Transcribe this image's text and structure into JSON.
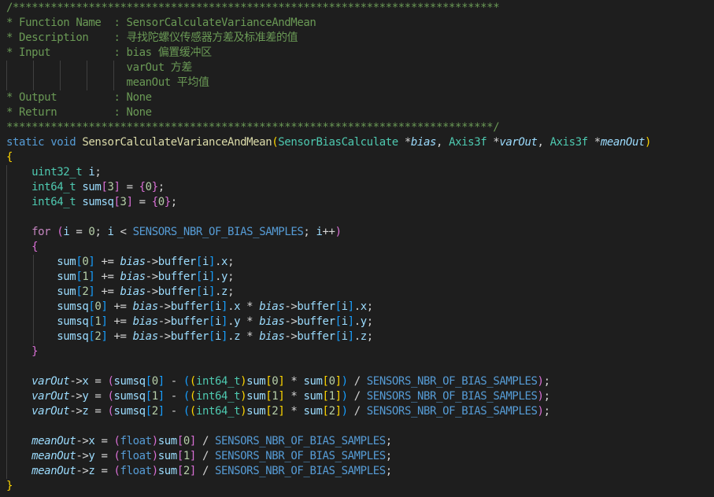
{
  "editor": {
    "theme_colors": {
      "background": "#1e1e1e",
      "comment": "#6a9955",
      "keyword": "#569cd6",
      "control": "#c586c0",
      "function": "#dcdcaa",
      "type": "#4ec9b0",
      "variable": "#9cdcfe",
      "number": "#b5cea8",
      "bracket_level1": "#ffd700",
      "bracket_level2": "#da70d6",
      "bracket_level3": "#179fff"
    },
    "lines": [
      [
        [
          "com",
          "/*****************************************************************************"
        ]
      ],
      [
        [
          "com",
          "* Function Name  : SensorCalculateVarianceAndMean"
        ]
      ],
      [
        [
          "com",
          "* Description    : 寻找陀螺仪传感器方差及标准差的值"
        ]
      ],
      [
        [
          "com",
          "* Input          : bias 偏置缓冲区"
        ]
      ],
      [
        [
          "com",
          "                   varOut 方差"
        ]
      ],
      [
        [
          "com",
          "                   meanOut 平均值"
        ]
      ],
      [
        [
          "com",
          "* Output         : None"
        ]
      ],
      [
        [
          "com",
          "* Return         : None"
        ]
      ],
      [
        [
          "com",
          "*****************************************************************************/"
        ]
      ],
      [
        [
          "kw",
          "static"
        ],
        [
          "pun",
          " "
        ],
        [
          "kw",
          "void"
        ],
        [
          "pun",
          " "
        ],
        [
          "fn",
          "SensorCalculateVarianceAndMean"
        ],
        [
          "b1",
          "("
        ],
        [
          "type",
          "SensorBiasCalculate"
        ],
        [
          "pun",
          " *"
        ],
        [
          "par",
          "bias"
        ],
        [
          "pun",
          ", "
        ],
        [
          "type",
          "Axis3f"
        ],
        [
          "pun",
          " *"
        ],
        [
          "par",
          "varOut"
        ],
        [
          "pun",
          ", "
        ],
        [
          "type",
          "Axis3f"
        ],
        [
          "pun",
          " *"
        ],
        [
          "par",
          "meanOut"
        ],
        [
          "b1",
          ")"
        ]
      ],
      [
        [
          "b1",
          "{"
        ]
      ],
      [
        [
          "pun",
          "    "
        ],
        [
          "type",
          "uint32_t"
        ],
        [
          "pun",
          " "
        ],
        [
          "var",
          "i"
        ],
        [
          "pun",
          ";"
        ]
      ],
      [
        [
          "pun",
          "    "
        ],
        [
          "type",
          "int64_t"
        ],
        [
          "pun",
          " "
        ],
        [
          "var",
          "sum"
        ],
        [
          "b2",
          "["
        ],
        [
          "num",
          "3"
        ],
        [
          "b2",
          "]"
        ],
        [
          "pun",
          " = "
        ],
        [
          "b2",
          "{"
        ],
        [
          "num",
          "0"
        ],
        [
          "b2",
          "}"
        ],
        [
          "pun",
          ";"
        ]
      ],
      [
        [
          "pun",
          "    "
        ],
        [
          "type",
          "int64_t"
        ],
        [
          "pun",
          " "
        ],
        [
          "var",
          "sumsq"
        ],
        [
          "b2",
          "["
        ],
        [
          "num",
          "3"
        ],
        [
          "b2",
          "]"
        ],
        [
          "pun",
          " = "
        ],
        [
          "b2",
          "{"
        ],
        [
          "num",
          "0"
        ],
        [
          "b2",
          "}"
        ],
        [
          "pun",
          ";"
        ]
      ],
      [
        [
          "pun",
          ""
        ]
      ],
      [
        [
          "pun",
          "    "
        ],
        [
          "ctl",
          "for"
        ],
        [
          "pun",
          " "
        ],
        [
          "b2",
          "("
        ],
        [
          "var",
          "i"
        ],
        [
          "pun",
          " = "
        ],
        [
          "num",
          "0"
        ],
        [
          "pun",
          "; "
        ],
        [
          "var",
          "i"
        ],
        [
          "pun",
          " < "
        ],
        [
          "mac",
          "SENSORS_NBR_OF_BIAS_SAMPLES"
        ],
        [
          "pun",
          "; "
        ],
        [
          "var",
          "i"
        ],
        [
          "pun",
          "++"
        ],
        [
          "b2",
          ")"
        ]
      ],
      [
        [
          "pun",
          "    "
        ],
        [
          "b2",
          "{"
        ]
      ],
      [
        [
          "pun",
          "        "
        ],
        [
          "var",
          "sum"
        ],
        [
          "b3",
          "["
        ],
        [
          "num",
          "0"
        ],
        [
          "b3",
          "]"
        ],
        [
          "pun",
          " += "
        ],
        [
          "par",
          "bias"
        ],
        [
          "pun",
          "->"
        ],
        [
          "var",
          "buffer"
        ],
        [
          "b3",
          "["
        ],
        [
          "var",
          "i"
        ],
        [
          "b3",
          "]"
        ],
        [
          "pun",
          "."
        ],
        [
          "var",
          "x"
        ],
        [
          "pun",
          ";"
        ]
      ],
      [
        [
          "pun",
          "        "
        ],
        [
          "var",
          "sum"
        ],
        [
          "b3",
          "["
        ],
        [
          "num",
          "1"
        ],
        [
          "b3",
          "]"
        ],
        [
          "pun",
          " += "
        ],
        [
          "par",
          "bias"
        ],
        [
          "pun",
          "->"
        ],
        [
          "var",
          "buffer"
        ],
        [
          "b3",
          "["
        ],
        [
          "var",
          "i"
        ],
        [
          "b3",
          "]"
        ],
        [
          "pun",
          "."
        ],
        [
          "var",
          "y"
        ],
        [
          "pun",
          ";"
        ]
      ],
      [
        [
          "pun",
          "        "
        ],
        [
          "var",
          "sum"
        ],
        [
          "b3",
          "["
        ],
        [
          "num",
          "2"
        ],
        [
          "b3",
          "]"
        ],
        [
          "pun",
          " += "
        ],
        [
          "par",
          "bias"
        ],
        [
          "pun",
          "->"
        ],
        [
          "var",
          "buffer"
        ],
        [
          "b3",
          "["
        ],
        [
          "var",
          "i"
        ],
        [
          "b3",
          "]"
        ],
        [
          "pun",
          "."
        ],
        [
          "var",
          "z"
        ],
        [
          "pun",
          ";"
        ]
      ],
      [
        [
          "pun",
          "        "
        ],
        [
          "var",
          "sumsq"
        ],
        [
          "b3",
          "["
        ],
        [
          "num",
          "0"
        ],
        [
          "b3",
          "]"
        ],
        [
          "pun",
          " += "
        ],
        [
          "par",
          "bias"
        ],
        [
          "pun",
          "->"
        ],
        [
          "var",
          "buffer"
        ],
        [
          "b3",
          "["
        ],
        [
          "var",
          "i"
        ],
        [
          "b3",
          "]"
        ],
        [
          "pun",
          "."
        ],
        [
          "var",
          "x"
        ],
        [
          "pun",
          " * "
        ],
        [
          "par",
          "bias"
        ],
        [
          "pun",
          "->"
        ],
        [
          "var",
          "buffer"
        ],
        [
          "b3",
          "["
        ],
        [
          "var",
          "i"
        ],
        [
          "b3",
          "]"
        ],
        [
          "pun",
          "."
        ],
        [
          "var",
          "x"
        ],
        [
          "pun",
          ";"
        ]
      ],
      [
        [
          "pun",
          "        "
        ],
        [
          "var",
          "sumsq"
        ],
        [
          "b3",
          "["
        ],
        [
          "num",
          "1"
        ],
        [
          "b3",
          "]"
        ],
        [
          "pun",
          " += "
        ],
        [
          "par",
          "bias"
        ],
        [
          "pun",
          "->"
        ],
        [
          "var",
          "buffer"
        ],
        [
          "b3",
          "["
        ],
        [
          "var",
          "i"
        ],
        [
          "b3",
          "]"
        ],
        [
          "pun",
          "."
        ],
        [
          "var",
          "y"
        ],
        [
          "pun",
          " * "
        ],
        [
          "par",
          "bias"
        ],
        [
          "pun",
          "->"
        ],
        [
          "var",
          "buffer"
        ],
        [
          "b3",
          "["
        ],
        [
          "var",
          "i"
        ],
        [
          "b3",
          "]"
        ],
        [
          "pun",
          "."
        ],
        [
          "var",
          "y"
        ],
        [
          "pun",
          ";"
        ]
      ],
      [
        [
          "pun",
          "        "
        ],
        [
          "var",
          "sumsq"
        ],
        [
          "b3",
          "["
        ],
        [
          "num",
          "2"
        ],
        [
          "b3",
          "]"
        ],
        [
          "pun",
          " += "
        ],
        [
          "par",
          "bias"
        ],
        [
          "pun",
          "->"
        ],
        [
          "var",
          "buffer"
        ],
        [
          "b3",
          "["
        ],
        [
          "var",
          "i"
        ],
        [
          "b3",
          "]"
        ],
        [
          "pun",
          "."
        ],
        [
          "var",
          "z"
        ],
        [
          "pun",
          " * "
        ],
        [
          "par",
          "bias"
        ],
        [
          "pun",
          "->"
        ],
        [
          "var",
          "buffer"
        ],
        [
          "b3",
          "["
        ],
        [
          "var",
          "i"
        ],
        [
          "b3",
          "]"
        ],
        [
          "pun",
          "."
        ],
        [
          "var",
          "z"
        ],
        [
          "pun",
          ";"
        ]
      ],
      [
        [
          "pun",
          "    "
        ],
        [
          "b2",
          "}"
        ]
      ],
      [
        [
          "pun",
          ""
        ]
      ],
      [
        [
          "pun",
          "    "
        ],
        [
          "par",
          "varOut"
        ],
        [
          "pun",
          "->"
        ],
        [
          "var",
          "x"
        ],
        [
          "pun",
          " = "
        ],
        [
          "b2",
          "("
        ],
        [
          "var",
          "sumsq"
        ],
        [
          "b3",
          "["
        ],
        [
          "num",
          "0"
        ],
        [
          "b3",
          "]"
        ],
        [
          "pun",
          " - "
        ],
        [
          "b3",
          "("
        ],
        [
          "b1",
          "("
        ],
        [
          "type",
          "int64_t"
        ],
        [
          "b1",
          ")"
        ],
        [
          "var",
          "sum"
        ],
        [
          "b1",
          "["
        ],
        [
          "num",
          "0"
        ],
        [
          "b1",
          "]"
        ],
        [
          "pun",
          " * "
        ],
        [
          "var",
          "sum"
        ],
        [
          "b1",
          "["
        ],
        [
          "num",
          "0"
        ],
        [
          "b1",
          "]"
        ],
        [
          "b3",
          ")"
        ],
        [
          "pun",
          " / "
        ],
        [
          "mac",
          "SENSORS_NBR_OF_BIAS_SAMPLES"
        ],
        [
          "b2",
          ")"
        ],
        [
          "pun",
          ";"
        ]
      ],
      [
        [
          "pun",
          "    "
        ],
        [
          "par",
          "varOut"
        ],
        [
          "pun",
          "->"
        ],
        [
          "var",
          "y"
        ],
        [
          "pun",
          " = "
        ],
        [
          "b2",
          "("
        ],
        [
          "var",
          "sumsq"
        ],
        [
          "b3",
          "["
        ],
        [
          "num",
          "1"
        ],
        [
          "b3",
          "]"
        ],
        [
          "pun",
          " - "
        ],
        [
          "b3",
          "("
        ],
        [
          "b1",
          "("
        ],
        [
          "type",
          "int64_t"
        ],
        [
          "b1",
          ")"
        ],
        [
          "var",
          "sum"
        ],
        [
          "b1",
          "["
        ],
        [
          "num",
          "1"
        ],
        [
          "b1",
          "]"
        ],
        [
          "pun",
          " * "
        ],
        [
          "var",
          "sum"
        ],
        [
          "b1",
          "["
        ],
        [
          "num",
          "1"
        ],
        [
          "b1",
          "]"
        ],
        [
          "b3",
          ")"
        ],
        [
          "pun",
          " / "
        ],
        [
          "mac",
          "SENSORS_NBR_OF_BIAS_SAMPLES"
        ],
        [
          "b2",
          ")"
        ],
        [
          "pun",
          ";"
        ]
      ],
      [
        [
          "pun",
          "    "
        ],
        [
          "par",
          "varOut"
        ],
        [
          "pun",
          "->"
        ],
        [
          "var",
          "z"
        ],
        [
          "pun",
          " = "
        ],
        [
          "b2",
          "("
        ],
        [
          "var",
          "sumsq"
        ],
        [
          "b3",
          "["
        ],
        [
          "num",
          "2"
        ],
        [
          "b3",
          "]"
        ],
        [
          "pun",
          " - "
        ],
        [
          "b3",
          "("
        ],
        [
          "b1",
          "("
        ],
        [
          "type",
          "int64_t"
        ],
        [
          "b1",
          ")"
        ],
        [
          "var",
          "sum"
        ],
        [
          "b1",
          "["
        ],
        [
          "num",
          "2"
        ],
        [
          "b1",
          "]"
        ],
        [
          "pun",
          " * "
        ],
        [
          "var",
          "sum"
        ],
        [
          "b1",
          "["
        ],
        [
          "num",
          "2"
        ],
        [
          "b1",
          "]"
        ],
        [
          "b3",
          ")"
        ],
        [
          "pun",
          " / "
        ],
        [
          "mac",
          "SENSORS_NBR_OF_BIAS_SAMPLES"
        ],
        [
          "b2",
          ")"
        ],
        [
          "pun",
          ";"
        ]
      ],
      [
        [
          "pun",
          ""
        ]
      ],
      [
        [
          "pun",
          "    "
        ],
        [
          "par",
          "meanOut"
        ],
        [
          "pun",
          "->"
        ],
        [
          "var",
          "x"
        ],
        [
          "pun",
          " = "
        ],
        [
          "b2",
          "("
        ],
        [
          "kw",
          "float"
        ],
        [
          "b2",
          ")"
        ],
        [
          "var",
          "sum"
        ],
        [
          "b2",
          "["
        ],
        [
          "num",
          "0"
        ],
        [
          "b2",
          "]"
        ],
        [
          "pun",
          " / "
        ],
        [
          "mac",
          "SENSORS_NBR_OF_BIAS_SAMPLES"
        ],
        [
          "pun",
          ";"
        ]
      ],
      [
        [
          "pun",
          "    "
        ],
        [
          "par",
          "meanOut"
        ],
        [
          "pun",
          "->"
        ],
        [
          "var",
          "y"
        ],
        [
          "pun",
          " = "
        ],
        [
          "b2",
          "("
        ],
        [
          "kw",
          "float"
        ],
        [
          "b2",
          ")"
        ],
        [
          "var",
          "sum"
        ],
        [
          "b2",
          "["
        ],
        [
          "num",
          "1"
        ],
        [
          "b2",
          "]"
        ],
        [
          "pun",
          " / "
        ],
        [
          "mac",
          "SENSORS_NBR_OF_BIAS_SAMPLES"
        ],
        [
          "pun",
          ";"
        ]
      ],
      [
        [
          "pun",
          "    "
        ],
        [
          "par",
          "meanOut"
        ],
        [
          "pun",
          "->"
        ],
        [
          "var",
          "z"
        ],
        [
          "pun",
          " = "
        ],
        [
          "b2",
          "("
        ],
        [
          "kw",
          "float"
        ],
        [
          "b2",
          ")"
        ],
        [
          "var",
          "sum"
        ],
        [
          "b2",
          "["
        ],
        [
          "num",
          "2"
        ],
        [
          "b2",
          "]"
        ],
        [
          "pun",
          " / "
        ],
        [
          "mac",
          "SENSORS_NBR_OF_BIAS_SAMPLES"
        ],
        [
          "pun",
          ";"
        ]
      ],
      [
        [
          "b1",
          "}"
        ]
      ]
    ]
  }
}
